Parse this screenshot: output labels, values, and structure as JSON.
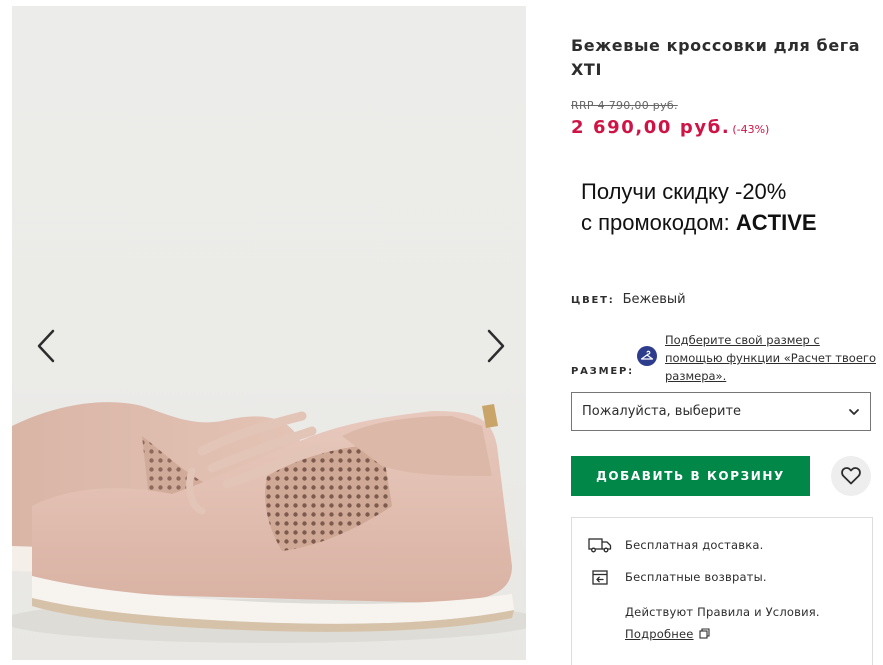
{
  "gallery": {
    "prev_icon": "chevron-left-icon",
    "next_icon": "chevron-right-icon"
  },
  "product": {
    "title": "Бежевые кроссовки для бега XTI",
    "rrp": "RRP 4 790,00 руб.",
    "price": "2 690,00 руб.",
    "discount": "(-43%)",
    "price_color": "#d01345"
  },
  "promo": {
    "line1": "Получи скидку -20%",
    "line2_prefix": "с промокодом: ",
    "code": "ACTIVE"
  },
  "color": {
    "label": "ЦВЕТ:",
    "value": "Бежевый"
  },
  "size": {
    "label": "РАЗМЕР:",
    "fit_link": "Подберите свой размер с помощью функции «Расчет твоего размера».",
    "select_placeholder": "Пожалуйста, выберите"
  },
  "actions": {
    "add_to_bag": "ДОБАВИТЬ В КОРЗИНУ",
    "add_color": "#018849"
  },
  "delivery": {
    "free_delivery": "Бесплатная доставка.",
    "free_returns": "Бесплатные возвраты.",
    "terms": "Действуют Правила и Условия.",
    "more": "Подробнее"
  }
}
